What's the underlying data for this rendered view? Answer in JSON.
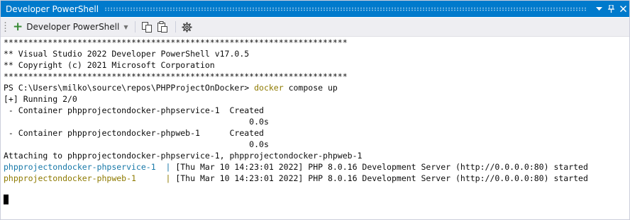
{
  "window": {
    "title": "Developer PowerShell",
    "titlebar_colors": {
      "background": "#007acc",
      "text": "#ffffff"
    },
    "buttons": [
      {
        "name": "dropdown-icon",
        "glyph": "▾"
      },
      {
        "name": "pin-icon",
        "glyph": "⊥"
      },
      {
        "name": "close-icon",
        "glyph": "✕"
      }
    ]
  },
  "toolbar": {
    "new_instance_label": "Developer PowerShell",
    "icons": [
      "plus-icon",
      "chevron-down-icon",
      "copy-icon",
      "paste-icon",
      "gear-icon"
    ]
  },
  "terminal": {
    "colors": {
      "background": "#ffffff",
      "text": "#0c0c0c",
      "command": "#8e7a00",
      "service_prefix": "#1778a8",
      "web_prefix": "#8e7a00"
    },
    "banner_line": "**********************************************************************",
    "header_line1": "** Visual Studio 2022 Developer PowerShell v17.0.5",
    "header_line2": "** Copyright (c) 2021 Microsoft Corporation",
    "banner_line2": "**********************************************************************",
    "prompt": "PS C:\\Users\\milko\\source\\repos\\PHPProjectOnDocker> ",
    "command_keyword": "docker",
    "command_args": " compose up",
    "running_line": "[+] Running 2/0",
    "container1_line": " - Container phpprojectondocker-phpservice-1  Created",
    "container1_time": "                                                  0.0s",
    "container2_line": " - Container phpprojectondocker-phpweb-1      Created",
    "container2_time": "                                                  0.0s",
    "attaching_line": "Attaching to phpprojectondocker-phpservice-1, phpprojectondocker-phpweb-1",
    "log1_prefix": "phpprojectondocker-phpservice-1  | ",
    "log1_message": "[Thu Mar 10 14:23:01 2022] PHP 8.0.16 Development Server (http://0.0.0.0:80) started",
    "log2_prefix": "phpprojectondocker-phpweb-1      | ",
    "log2_message": "[Thu Mar 10 14:23:01 2022] PHP 8.0.16 Development Server (http://0.0.0.0:80) started"
  }
}
